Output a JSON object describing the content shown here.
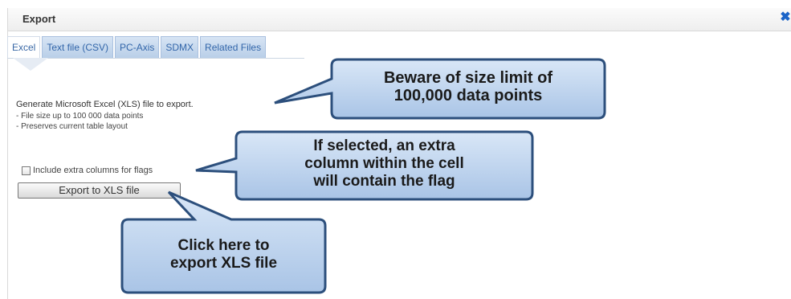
{
  "dialog": {
    "title": "Export",
    "close_icon": "close-icon"
  },
  "tabs": [
    {
      "label": "Excel",
      "active": true
    },
    {
      "label": "Text file (CSV)",
      "active": false
    },
    {
      "label": "PC-Axis",
      "active": false
    },
    {
      "label": "SDMX",
      "active": false
    },
    {
      "label": "Related Files",
      "active": false
    }
  ],
  "description": {
    "heading": "Generate Microsoft Excel (XLS) file to export.",
    "lines": [
      "- File size up to 100 000 data points",
      "- Preserves current table layout"
    ]
  },
  "options": {
    "flags_label": "Include extra columns for flags",
    "flags_checked": false
  },
  "export_button": {
    "label": "Export to XLS file"
  },
  "callouts": {
    "size_limit": {
      "line1": "Beware of size limit of",
      "line2": "100,000 data points"
    },
    "flags": {
      "line1": "If selected, an extra",
      "line2": "column within the cell",
      "line3": "will contain the flag"
    },
    "export": {
      "line1": "Click here to",
      "line2": "export XLS file"
    }
  },
  "colors": {
    "callout_fill": "#bcd3ee",
    "callout_border": "#2c4f7c",
    "tab_text": "#3366aa",
    "close": "#1b64c8"
  }
}
